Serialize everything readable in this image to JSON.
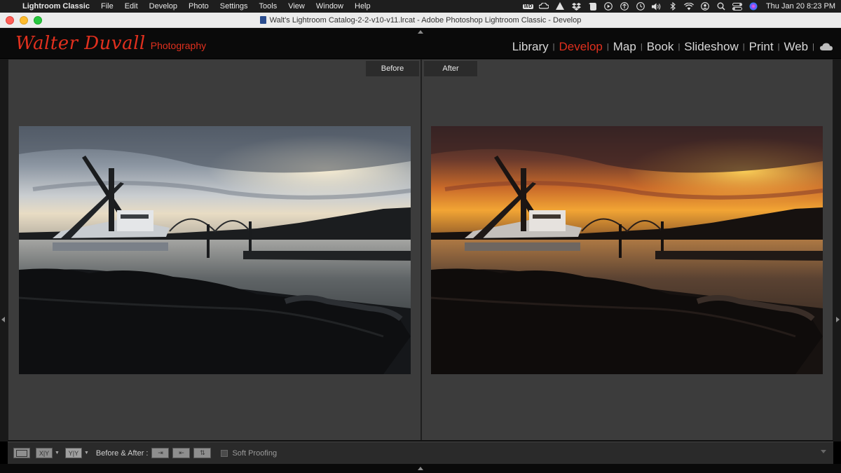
{
  "menubar": {
    "app_name": "Lightroom Classic",
    "items": [
      "File",
      "Edit",
      "Develop",
      "Photo",
      "Settings",
      "Tools",
      "View",
      "Window",
      "Help"
    ],
    "status_icons": [
      "wd-icon",
      "creative-cloud-icon",
      "script-editor-icon",
      "dropbox-icon",
      "evernote-icon",
      "play-icon",
      "tether-icon",
      "time-machine-icon",
      "volume-icon",
      "bluetooth-icon",
      "wifi-icon",
      "user-icon",
      "search-icon",
      "control-center-icon",
      "siri-icon"
    ],
    "wd_label": "WD",
    "clock": "Thu Jan 20  8:23 PM"
  },
  "window": {
    "title": "Walt's Lightroom Catalog-2-2-v10-v11.lrcat - Adobe Photoshop Lightroom Classic - Develop"
  },
  "identity_plate": {
    "script_text": "Walter Duvall",
    "sub_text": "Photography",
    "color": "#e1301e"
  },
  "modules": {
    "items": [
      {
        "label": "Library",
        "active": false
      },
      {
        "label": "Develop",
        "active": true
      },
      {
        "label": "Map",
        "active": false
      },
      {
        "label": "Book",
        "active": false
      },
      {
        "label": "Slideshow",
        "active": false
      },
      {
        "label": "Print",
        "active": false
      },
      {
        "label": "Web",
        "active": false
      }
    ],
    "separator": "|",
    "active_color": "#e1301e"
  },
  "view": {
    "before_label": "Before",
    "after_label": "After"
  },
  "toolbar": {
    "xy_label": "X|Y",
    "yy_label": "Y|Y",
    "before_after_label": "Before & After :",
    "copy_before_to_after": "⇥",
    "copy_after_to_before": "⇤",
    "swap": "⇅",
    "soft_proofing_label": "Soft Proofing",
    "soft_proofing_checked": false
  }
}
